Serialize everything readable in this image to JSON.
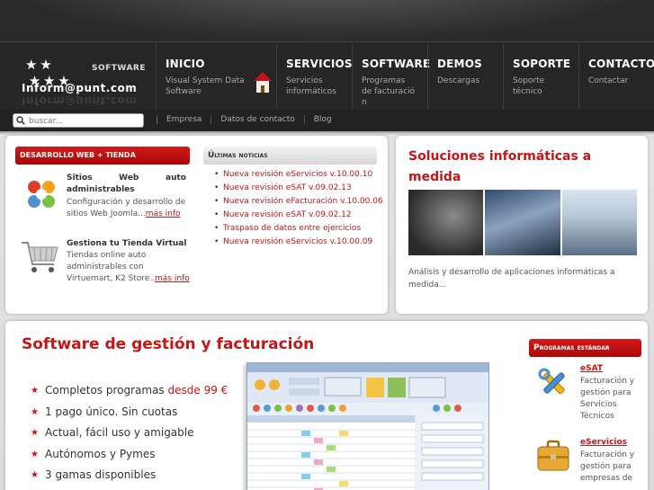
{
  "header": {
    "logo_software": "SOFTWARE",
    "logo_brand": "Inform@punt.com",
    "nav": [
      {
        "title": "INICIO",
        "sub": "Visual System Data Software"
      },
      {
        "title": "SERVICIOS",
        "sub": "Servicios informáticos"
      },
      {
        "title": "SOFTWARE",
        "sub": "Programas de facturació n"
      },
      {
        "title": "DEMOS",
        "sub": "Descargas"
      },
      {
        "title": "SOPORTE",
        "sub": "Soporte técnico"
      },
      {
        "title": "CONTACTO",
        "sub": "Contactar"
      }
    ]
  },
  "search": {
    "placeholder": "buscar...",
    "links": [
      "Empresa",
      "Datos de contacto",
      "Blog"
    ]
  },
  "panel1": {
    "tab": "Desarrollo web + tienda",
    "item1": {
      "title": "Sitios Web auto administrables",
      "text": "Configuración y desarrollo de sitios Web Joomla...",
      "more": "más info"
    },
    "item2": {
      "title": "Gestiona tu Tienda Virtual",
      "text": "Tiendas online auto administrables con Virtuemart, K2 Store...",
      "more": "más info"
    },
    "news_tab": "Últimas noticias",
    "news": [
      "Nueva revisión eServicios v.10.00.10",
      "Nueva revisión eSAT v.09.02.13",
      "Nueva revisión eFacturación v.10.00.06",
      "Nueva revisión eSAT v.09.02.12",
      "Traspaso de datos entre ejercicios",
      "Nueva revisión eServicios v.10.00.09"
    ]
  },
  "panel2": {
    "title": "Soluciones informáticas a medida",
    "desc": "Análisis y desarrollo de aplicaciones informáticas a medida..."
  },
  "panel3": {
    "title": "Software de gestión y facturación",
    "features": [
      {
        "text": "Completos programas ",
        "highlight": "desde 99 €"
      },
      {
        "text": "1 pago único. Sin cuotas",
        "highlight": ""
      },
      {
        "text": "Actual, fácil uso y amigable",
        "highlight": ""
      },
      {
        "text": "Autónomos y Pymes",
        "highlight": ""
      },
      {
        "text": "3 gamas disponibles",
        "highlight": ""
      }
    ],
    "programs_tab": "Programas estándar",
    "programs": [
      {
        "name": "eSAT",
        "text": "Facturación y gestión para Servicios Técnicos"
      },
      {
        "name": "eServicios",
        "text": "Facturación y gestión para empresas de"
      }
    ]
  },
  "colors": {
    "accent": "#c41616",
    "header_bg": "#262626",
    "page_bg": "#dcdcdc"
  }
}
